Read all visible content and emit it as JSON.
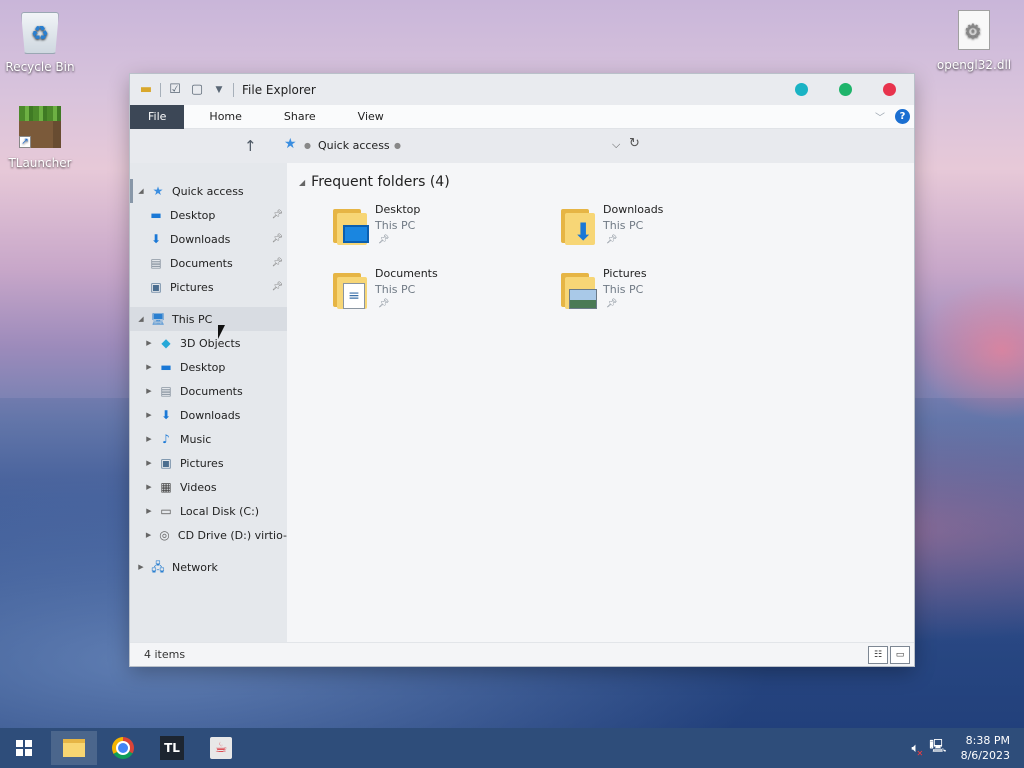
{
  "desktop": {
    "icons": {
      "recycle_bin": "Recycle Bin",
      "tlauncher": "TLauncher",
      "opengl": "opengl32.dll"
    }
  },
  "window": {
    "title": "File Explorer",
    "controls": {
      "minimize_color": "#1ab3c4",
      "maximize_color": "#1fb46b",
      "close_color": "#e8334d"
    },
    "ribbon": {
      "tabs": [
        "File",
        "Home",
        "Share",
        "View"
      ],
      "help": "?"
    },
    "address": {
      "path": "Quick access"
    },
    "nav": {
      "quick_access": "Quick access",
      "qa_items": [
        "Desktop",
        "Downloads",
        "Documents",
        "Pictures"
      ],
      "this_pc": "This PC",
      "pc_items": [
        "3D Objects",
        "Desktop",
        "Documents",
        "Downloads",
        "Music",
        "Pictures",
        "Videos",
        "Local Disk (C:)",
        "CD Drive (D:) virtio-"
      ],
      "network": "Network"
    },
    "main": {
      "section_title": "Frequent folders (4)",
      "folders": [
        {
          "name": "Desktop",
          "location": "This PC"
        },
        {
          "name": "Downloads",
          "location": "This PC"
        },
        {
          "name": "Documents",
          "location": "This PC"
        },
        {
          "name": "Pictures",
          "location": "This PC"
        }
      ]
    },
    "status": {
      "items": "4 items"
    }
  },
  "taskbar": {
    "apps": [
      "start",
      "file-explorer",
      "chromium",
      "tlauncher",
      "java"
    ],
    "clock": {
      "time": "8:38 PM",
      "date": "8/6/2023"
    }
  }
}
